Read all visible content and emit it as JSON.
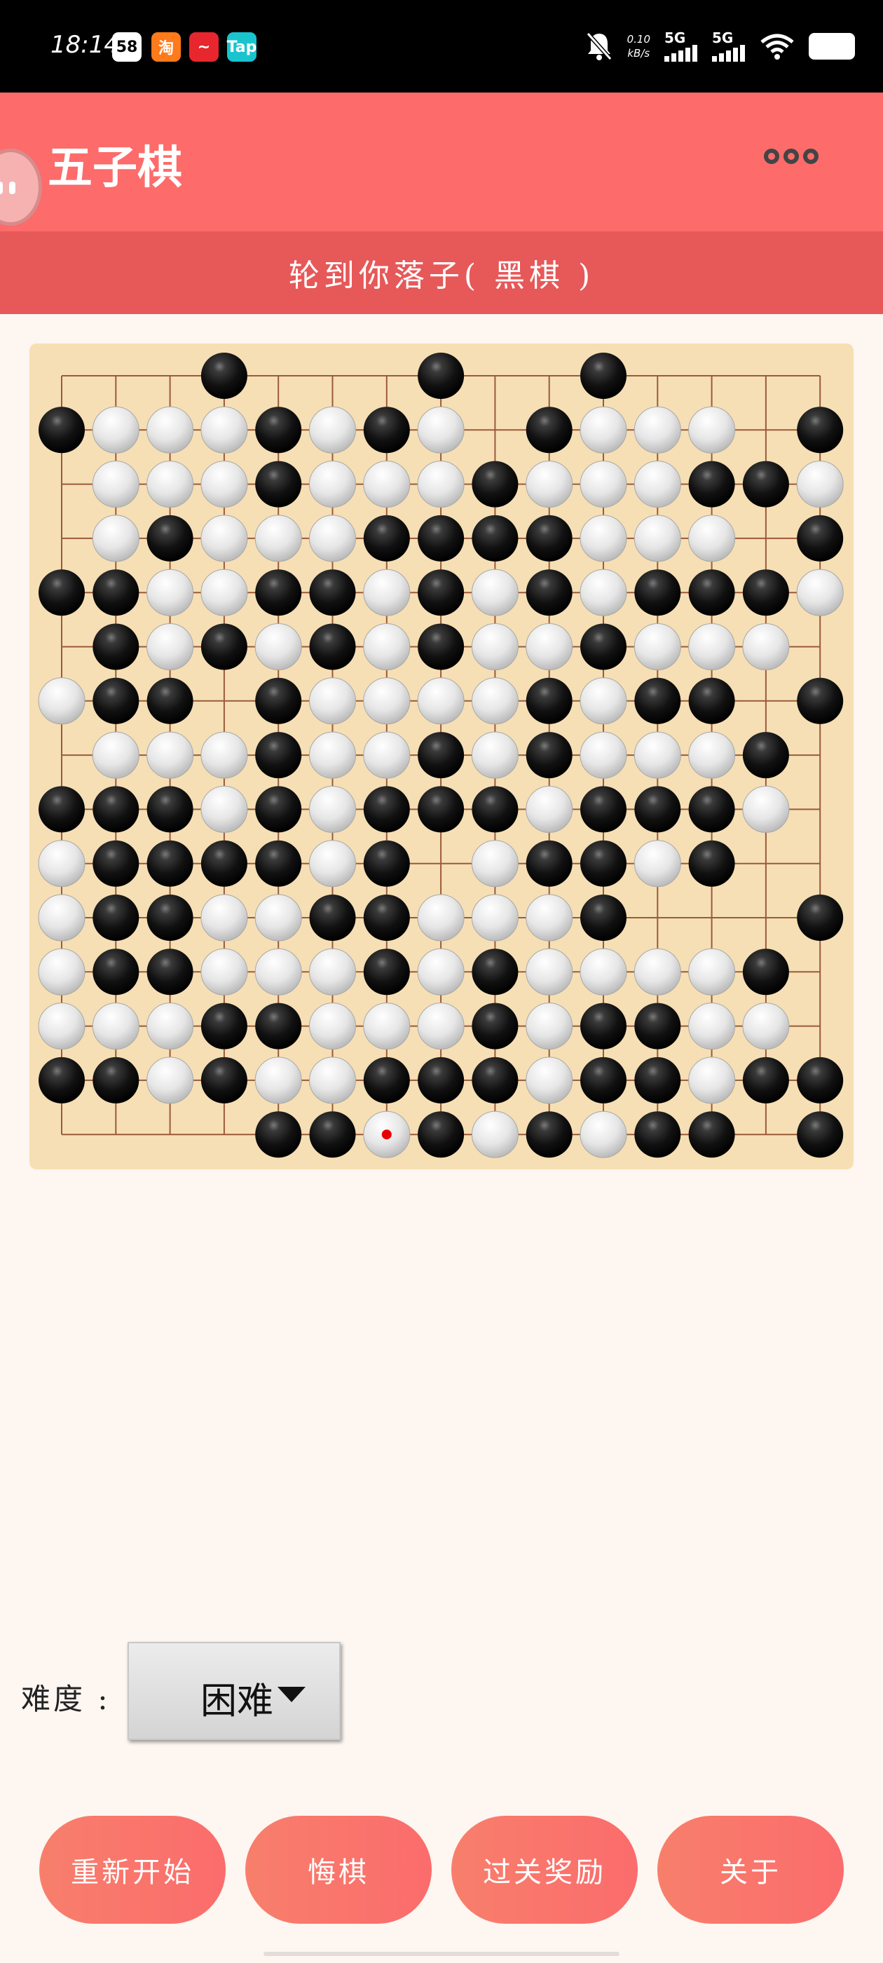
{
  "status_bar": {
    "time": "18:14",
    "apps": [
      {
        "label": "58",
        "bg": "#ffffff",
        "fg": "#000000"
      },
      {
        "label": "淘",
        "bg": "#ff7a1a",
        "fg": "#ffffff"
      },
      {
        "label": "~",
        "bg": "#e8262d",
        "fg": "#ffffff"
      },
      {
        "label": "Tap",
        "bg": "#19c4cf",
        "fg": "#ffffff"
      }
    ],
    "net_speed_value": "0.10",
    "net_speed_unit": "kB/s",
    "signal1": "5G",
    "signal2": "5G"
  },
  "header": {
    "title": "五子棋"
  },
  "turn_banner": "轮到你落子( 黑棋 )",
  "colors": {
    "header": "#fd6b6b",
    "banner": "#e75858",
    "board": "#f6dfb4",
    "grid": "#9b5a3b",
    "last_move_marker": "#e60000"
  },
  "board": {
    "size": 15,
    "legend": "B = black stone, W = white stone, . = empty",
    "rows": [
      "...B...B..B....",
      "BWWWBWBW.BWWW.B",
      ".WWWBWWWBWWWBBW",
      ".WBWWWBBBBWWW.B",
      "BBWWBBWBWBWBBBW",
      ".BWBWBWBWWBWWW.",
      "WBB.BWWWWBWBB.B",
      ".WWWBWWBWBWWWB.",
      "BBBWBWBBBWBBBW.",
      "WBBBBWB.WBBWB..",
      "WBBWWBBWWWB...B",
      "WBBWWWBWBWWWWB.",
      "WWWBBWWWBWBBWW.",
      "BBWBWWBBBWBBWBB",
      "....BBWBWBWBB.B"
    ],
    "last_move": {
      "row": 14,
      "col": 6
    }
  },
  "difficulty": {
    "label": "难度 :",
    "value": "困难"
  },
  "buttons": {
    "restart": "重新开始",
    "undo": "悔棋",
    "reward": "过关奖励",
    "about": "关于"
  }
}
